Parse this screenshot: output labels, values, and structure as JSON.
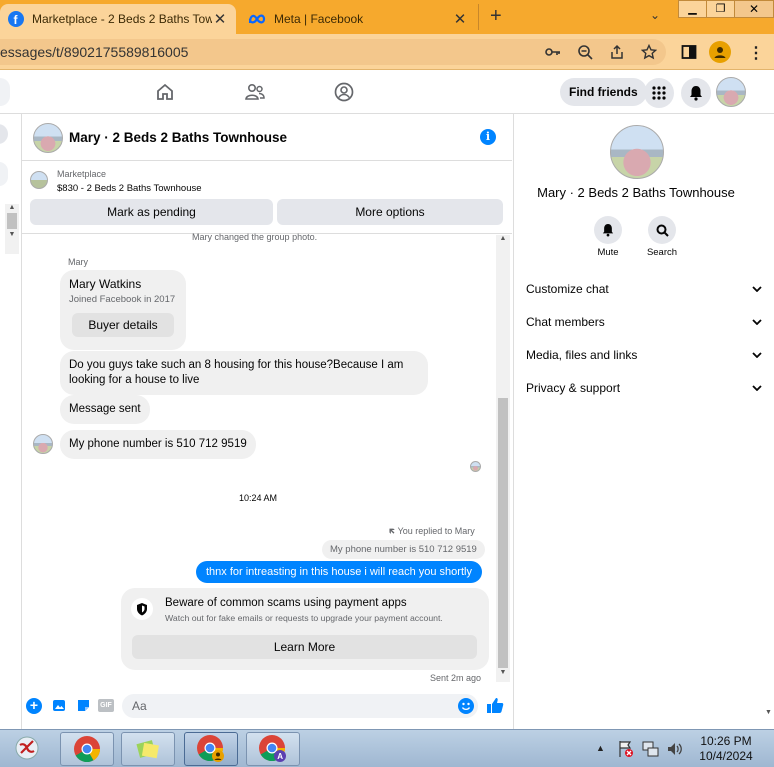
{
  "browser": {
    "tabs": [
      {
        "title": "Marketplace - 2 Beds 2 Baths Tow"
      },
      {
        "title": "Meta | Facebook"
      }
    ],
    "url": "essages/t/8902175589816005"
  },
  "fb_header": {
    "find_friends": "Find friends"
  },
  "chat": {
    "title": "Mary · 2 Beds 2 Baths Townhouse",
    "listing": {
      "label": "Marketplace",
      "detail": "$830 - 2 Beds 2 Baths Townhouse"
    },
    "mark_pending": "Mark as pending",
    "more_options": "More options",
    "system_message": "Mary changed the group photo.",
    "sender_name": "Mary",
    "profile_card": {
      "name": "Mary Watkins",
      "joined": "Joined Facebook in 2017",
      "button": "Buyer details"
    },
    "messages": [
      {
        "text": "Do you guys take such an 8 housing for this house?Because I am looking for a house to live"
      },
      {
        "text": "Message sent"
      },
      {
        "text": "My phone number is 510 712 9519"
      }
    ],
    "timestamp": "10:24 AM",
    "reply_note": "You replied to Mary",
    "quoted": "My phone number is 510 712 9519",
    "my_message": "thnx for intreasting in this house i will reach you shortly",
    "warning": {
      "title": "Beware of common scams using payment apps",
      "body": "Watch out for fake emails or requests to upgrade your payment account.",
      "button": "Learn More"
    },
    "sent_status": "Sent 2m ago",
    "composer_placeholder": "Aa"
  },
  "right_panel": {
    "name": "Mary · 2 Beds 2 Baths Townhouse",
    "mute": "Mute",
    "search": "Search",
    "menu": [
      {
        "label": "Customize chat"
      },
      {
        "label": "Chat members"
      },
      {
        "label": "Media, files and links"
      },
      {
        "label": "Privacy & support"
      }
    ]
  },
  "taskbar": {
    "time": "10:26 PM",
    "date": "10/4/2024"
  },
  "colors": {
    "accent": "#0084ff",
    "chrome_tabbar": "#f6a92d",
    "chrome_toolbar": "#fbd49a"
  }
}
